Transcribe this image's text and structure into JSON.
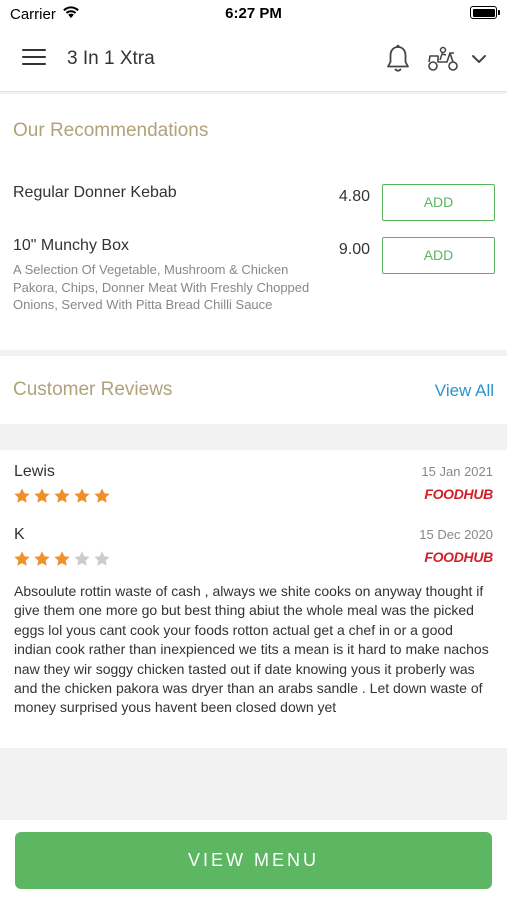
{
  "status_bar": {
    "carrier": "Carrier",
    "time": "6:27 PM"
  },
  "header": {
    "store_name": "3 In 1 Xtra"
  },
  "recommendations": {
    "title": "Our Recommendations",
    "items": [
      {
        "name": "Regular Donner Kebab",
        "description": "",
        "price": "4.80",
        "add_label": "ADD"
      },
      {
        "name": "10\" Munchy Box",
        "description": "A Selection Of Vegetable, Mushroom & Chicken Pakora, Chips, Donner Meat With Freshly Chopped Onions, Served With Pitta Bread Chilli Sauce",
        "price": "9.00",
        "add_label": "ADD"
      }
    ]
  },
  "reviews": {
    "title": "Customer Reviews",
    "view_all_label": "View All",
    "items": [
      {
        "author": "Lewis",
        "date": "15 Jan 2021",
        "rating": 5,
        "source": "FOODHUB",
        "text": ""
      },
      {
        "author": "K",
        "date": "15 Dec 2020",
        "rating": 3,
        "source": "FOODHUB",
        "text": "Absoulute rottin waste of cash , always we shite cooks on anyway thought if give them one more go but best thing abiut the whole meal was the picked eggs lol yous cant cook your foods rotton actual get a chef in or a good indian cook rather than inexpienced we tits a mean is it hard to make nachos naw they wir soggy chicken tasted out if date knowing yous it proberly was and the chicken pakora was dryer than an arabs sandle . Let down waste of money surprised yous havent been closed down yet"
      }
    ]
  },
  "footer": {
    "view_menu_label": "VIEW MENU"
  },
  "colors": {
    "accent_green": "#5cb662",
    "title_gold": "#b0a27a",
    "link_blue": "#2b95c9",
    "star_on": "#f0902a",
    "star_off": "#cccccc",
    "foodhub_red": "#d31f26"
  }
}
